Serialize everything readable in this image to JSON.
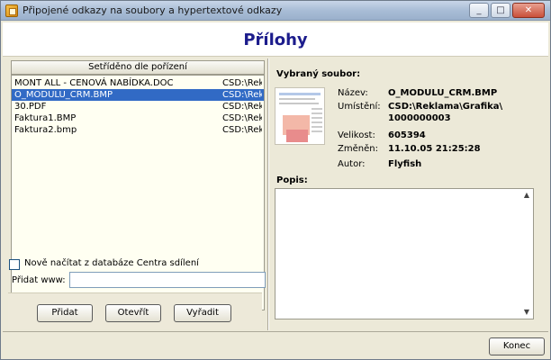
{
  "window": {
    "title": "Připojené odkazy na soubory a hypertextové odkazy",
    "controls": {
      "minimize": "_",
      "maximize": "□",
      "close": "✕"
    }
  },
  "header": {
    "title": "Přílohy"
  },
  "list": {
    "sort_header": "Setříděno dle pořízení",
    "rows": [
      {
        "name": "MONT ALL - CENOVÁ NABÍDKA.DOC",
        "path": "CSD:\\Reklama",
        "selected": false
      },
      {
        "name": "O_MODULU_CRM.BMP",
        "path": "CSD:\\Reklama",
        "selected": true
      },
      {
        "name": "30.PDF",
        "path": "CSD:\\Reklama",
        "selected": false
      },
      {
        "name": "Faktura1.BMP",
        "path": "CSD:\\Reklama",
        "selected": false
      },
      {
        "name": "Faktura2.bmp",
        "path": "CSD:\\Reklama",
        "selected": false
      }
    ]
  },
  "reload": {
    "label": "Nově načítat z databáze Centra sdílení",
    "checked": false
  },
  "www": {
    "label": "Přidat www:",
    "value": ""
  },
  "buttons": {
    "add": "Přidat",
    "open": "Otevřít",
    "remove": "Vyřadit",
    "end": "Konec"
  },
  "selected_file": {
    "heading": "Vybraný soubor:",
    "name_label": "Název:",
    "name": "O_MODULU_CRM.BMP",
    "location_label": "Umístění:",
    "location_line1": "CSD:\\Reklama\\Grafika\\",
    "location_line2": "1000000003",
    "size_label": "Velikost:",
    "size": "605394",
    "changed_label": "Změněn:",
    "changed": "11.10.05 21:25:28",
    "author_label": "Autor:",
    "author": "Flyfish"
  },
  "description": {
    "label": "Popis:",
    "value": ""
  },
  "icons": {
    "app": "attachment-app-icon",
    "thumbnail": "file-thumbnail-icon",
    "scroll_up": "▲",
    "scroll_down": "▼"
  }
}
